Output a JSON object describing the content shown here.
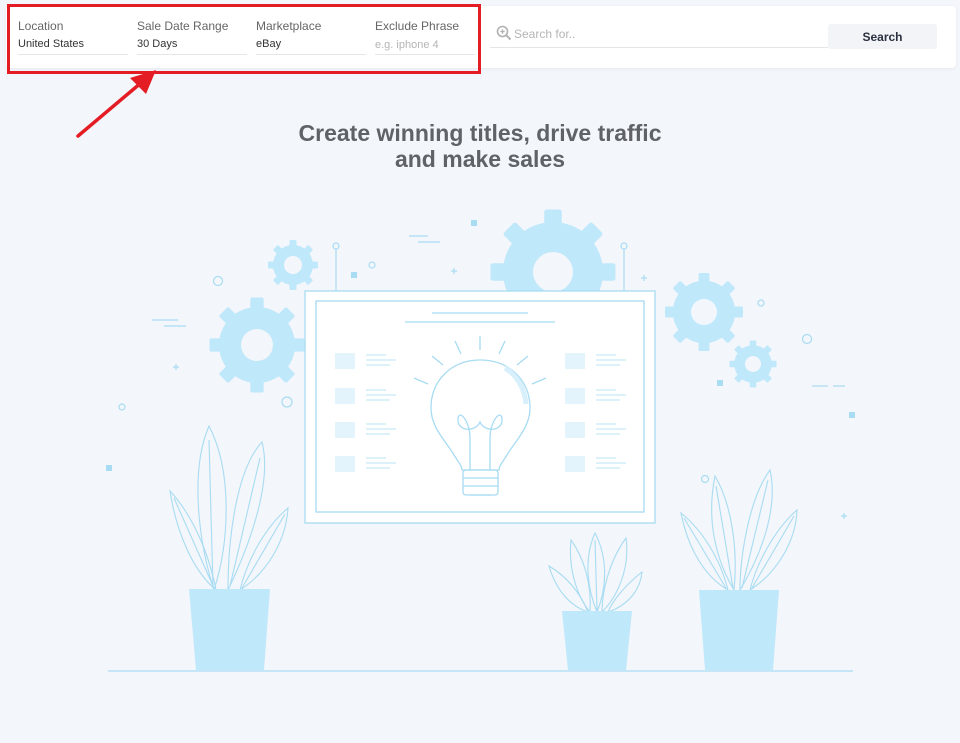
{
  "filters": {
    "location": {
      "label": "Location",
      "value": "United States"
    },
    "date_range": {
      "label": "Sale Date Range",
      "value": "30 Days"
    },
    "marketplace": {
      "label": "Marketplace",
      "value": "eBay"
    },
    "exclude": {
      "label": "Exclude Phrase",
      "placeholder": "e.g. iphone 4"
    }
  },
  "search": {
    "placeholder": "Search for..",
    "button_label": "Search",
    "icon": "search-icon"
  },
  "hero": {
    "line1": "Create winning titles, drive traffic",
    "line2": "and make sales"
  },
  "colors": {
    "highlight": "#e41d24",
    "accent_light_blue": "#bfe8fb",
    "stroke_blue": "#a8dcf2",
    "title_gray": "#5f6266"
  }
}
